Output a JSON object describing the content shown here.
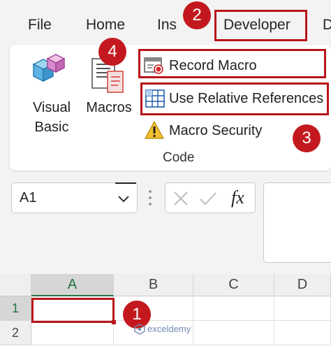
{
  "menu_tabs": [
    "File",
    "Home",
    "Ins",
    "Developer",
    "D"
  ],
  "ribbon": {
    "visual_basic_line1": "Visual",
    "visual_basic_line2": "Basic",
    "macros_label": "Macros",
    "record_macro": "Record Macro",
    "use_relative_references": "Use Relative References",
    "macro_security": "Macro Security",
    "group_label": "Code"
  },
  "formula_bar": {
    "name_box_value": "A1",
    "fx_label": "fx"
  },
  "grid": {
    "columns": [
      "A",
      "B",
      "C",
      "D"
    ],
    "rows": [
      "1",
      "2"
    ]
  },
  "badges": [
    "1",
    "2",
    "3",
    "4"
  ],
  "watermark": "exceldemy",
  "colors": {
    "accent_red": "#b8161a",
    "badge_red": "#c3191e",
    "selected_col": "#d6d6d6"
  }
}
